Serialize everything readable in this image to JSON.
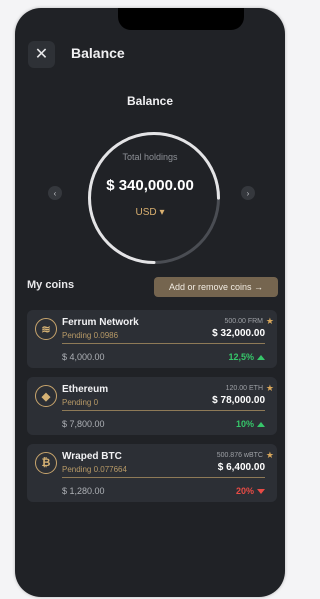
{
  "header": {
    "close_icon": "close-icon",
    "title": "Balance"
  },
  "balance": {
    "label": "Balance",
    "holdings_label": "Total holdings",
    "holdings_value": "$ 340,000.00",
    "currency": "USD",
    "currency_caret": "▾",
    "ring_progress": 0.75,
    "left_arrow": "‹",
    "right_arrow": "›"
  },
  "my_coins": {
    "label": "My coins",
    "add_button": "Add or remove coins →"
  },
  "coins": [
    {
      "icon": "ferrum-icon",
      "symbol": "≋",
      "name": "Ferrum Network",
      "pending": "Pending 0.0986",
      "amount": "500.00 FRM",
      "value": "$ 32,000.00",
      "fiat": "$ 4,000.00",
      "change": "12,5%",
      "direction": "up"
    },
    {
      "icon": "ethereum-icon",
      "symbol": "◆",
      "name": "Ethereum",
      "pending": "Pending 0",
      "amount": "120.00 ETH",
      "value": "$ 78,000.00",
      "fiat": "$ 7,800.00",
      "change": "10%",
      "direction": "up"
    },
    {
      "icon": "bitcoin-icon",
      "symbol": "₿",
      "name": "Wraped BTC",
      "pending": "Pending 0.077664",
      "amount": "500.876 wBTC",
      "value": "$ 6,400.00",
      "fiat": "$ 1,280.00",
      "change": "20%",
      "direction": "down"
    }
  ],
  "colors": {
    "background": "#202226",
    "card": "#2c2f35",
    "accent": "#d9b070",
    "up": "#36c66a",
    "down": "#e84b45"
  }
}
